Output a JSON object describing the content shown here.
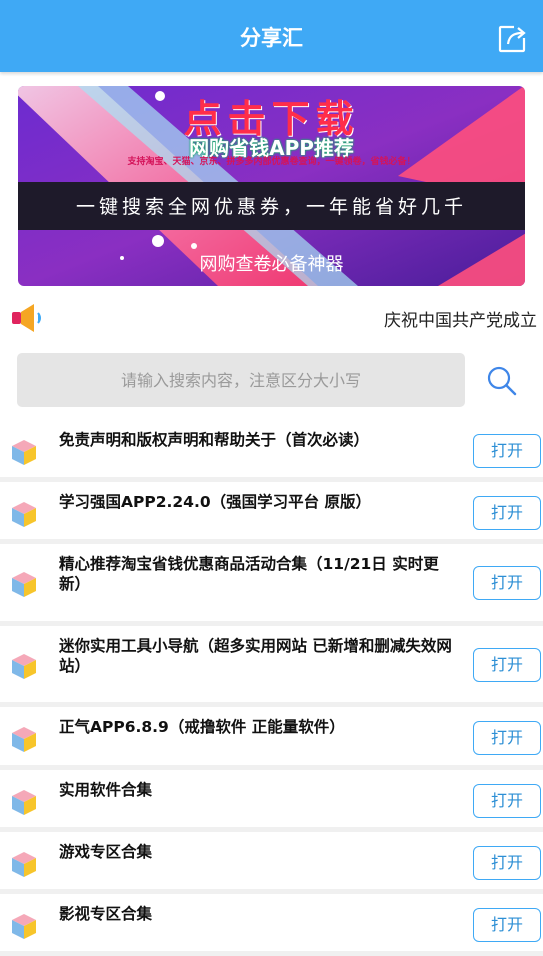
{
  "header": {
    "title": "分享汇",
    "share_icon": "share-icon"
  },
  "banner": {
    "title": "点击下载",
    "subtitle": "网购省钱APP推荐",
    "small_text": "支持淘宝、天猫、京东、拼多多内部优惠卷查询，一键领卷，省钱必备！",
    "slogan": "一键搜索全网优惠券，一年能省好几千",
    "bottom_text": "网购查卷必备神器"
  },
  "notice": {
    "text": "庆祝中国共产党成立"
  },
  "search": {
    "placeholder": "请输入搜索内容，注意区分大小写",
    "value": ""
  },
  "list": {
    "open_label": "打开",
    "items": [
      {
        "title": "免责声明和版权声明和帮助关于（首次必读）"
      },
      {
        "title": "学习强国APP2.24.0（强国学习平台 原版）"
      },
      {
        "title": "精心推荐淘宝省钱优惠商品活动合集（11/21日 实时更新）"
      },
      {
        "title": "迷你实用工具小导航（超多实用网站 已新增和删减失效网站）"
      },
      {
        "title": "正气APP6.8.9（戒撸软件 正能量软件）"
      },
      {
        "title": "实用软件合集"
      },
      {
        "title": "游戏专区合集"
      },
      {
        "title": "影视专区合集"
      }
    ]
  },
  "colors": {
    "header": "#3fa9f5",
    "accent": "#2d8fd5",
    "search_bg": "#e5e5e5"
  }
}
